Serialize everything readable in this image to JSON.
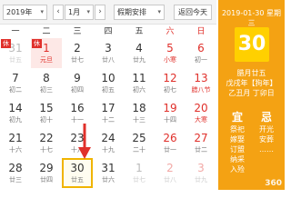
{
  "toolbar": {
    "year_select": "2019年",
    "prev_month": "‹",
    "month_select": "1月",
    "next_month": "›",
    "holiday_select": "假期安排",
    "today_button": "返回今天"
  },
  "weekdays": [
    "一",
    "二",
    "三",
    "四",
    "五",
    "六",
    "日"
  ],
  "weeks": [
    [
      {
        "day": "31",
        "lunar": "廿五",
        "other": true,
        "tag": "休"
      },
      {
        "day": "1",
        "lunar": "元旦",
        "holiday": true,
        "tag": "休"
      },
      {
        "day": "2",
        "lunar": "廿七"
      },
      {
        "day": "3",
        "lunar": "廿八"
      },
      {
        "day": "4",
        "lunar": "廿九"
      },
      {
        "day": "5",
        "lunar": "小寒",
        "weekend": true,
        "fest": true
      },
      {
        "day": "6",
        "lunar": "初一",
        "weekend": true
      }
    ],
    [
      {
        "day": "7",
        "lunar": "初二"
      },
      {
        "day": "8",
        "lunar": "初三"
      },
      {
        "day": "9",
        "lunar": "初四"
      },
      {
        "day": "10",
        "lunar": "初五"
      },
      {
        "day": "11",
        "lunar": "初六"
      },
      {
        "day": "12",
        "lunar": "初七",
        "weekend": true
      },
      {
        "day": "13",
        "lunar": "腊八节",
        "weekend": true,
        "fest": true
      }
    ],
    [
      {
        "day": "14",
        "lunar": "初九"
      },
      {
        "day": "15",
        "lunar": "初十"
      },
      {
        "day": "16",
        "lunar": "十一"
      },
      {
        "day": "17",
        "lunar": "十二"
      },
      {
        "day": "18",
        "lunar": "十三"
      },
      {
        "day": "19",
        "lunar": "十四",
        "weekend": true
      },
      {
        "day": "20",
        "lunar": "大寒",
        "weekend": true,
        "fest": true
      }
    ],
    [
      {
        "day": "21",
        "lunar": "十六"
      },
      {
        "day": "22",
        "lunar": "十七"
      },
      {
        "day": "23",
        "lunar": "十八"
      },
      {
        "day": "24",
        "lunar": "十九"
      },
      {
        "day": "25",
        "lunar": "二十"
      },
      {
        "day": "26",
        "lunar": "廿一",
        "weekend": true
      },
      {
        "day": "27",
        "lunar": "廿二",
        "weekend": true
      }
    ],
    [
      {
        "day": "28",
        "lunar": "廿三"
      },
      {
        "day": "29",
        "lunar": "廿四"
      },
      {
        "day": "30",
        "lunar": "廿五",
        "selected": true
      },
      {
        "day": "31",
        "lunar": "廿六"
      },
      {
        "day": "1",
        "lunar": "廿七",
        "other": true
      },
      {
        "day": "2",
        "lunar": "廿八",
        "other": true,
        "weekend": true
      },
      {
        "day": "3",
        "lunar": "廿九",
        "other": true,
        "weekend": true
      }
    ]
  ],
  "panel": {
    "date_line": "2019-01-30 星期三",
    "big_day": "30",
    "lunar_date": "腊月廿五",
    "ganzhi_year": "戊戌年【狗年】",
    "ganzhi_month_day": "乙丑月 丁卯日",
    "yi_label": "宜",
    "ji_label": "忌",
    "yi_items": [
      "祭祀",
      "嫁娶",
      "订盟",
      "纳采",
      "入殓"
    ],
    "ji_items": [
      "开光",
      "安葬",
      "……"
    ],
    "watermark": "360"
  },
  "colors": {
    "panel": "#f4a213",
    "big_day_bg": "#ffd000",
    "red": "#e0302b",
    "selected_border": "#f0b400"
  }
}
